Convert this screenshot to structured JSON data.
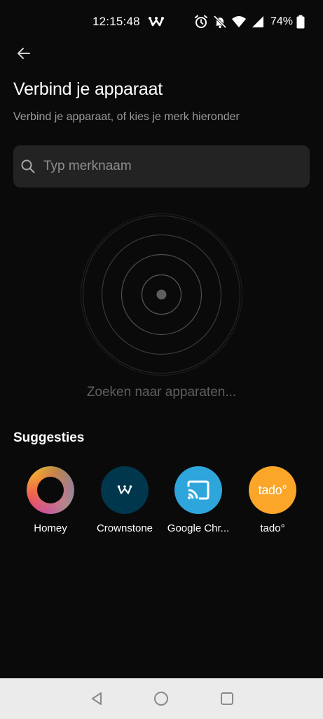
{
  "status_bar": {
    "time": "12:15:48",
    "battery_percent": "74%",
    "icons": [
      "crownstone-app-icon",
      "alarm-icon",
      "bell-off-icon",
      "wifi-icon",
      "signal-icon",
      "battery-icon"
    ]
  },
  "header": {
    "back_icon": "arrow-left-icon",
    "title": "Verbind je apparaat",
    "subtitle": "Verbind je apparaat, of kies je merk hieronder"
  },
  "search": {
    "placeholder": "Typ merknaam",
    "value": ""
  },
  "scan": {
    "status_text": "Zoeken naar apparaten..."
  },
  "suggestions": {
    "title": "Suggesties",
    "items": [
      {
        "label": "Homey",
        "icon": "homey-logo",
        "color": "#e0405f"
      },
      {
        "label": "Crownstone",
        "icon": "crownstone-logo",
        "color": "#00374c"
      },
      {
        "label": "Google Chr...",
        "icon": "chromecast-logo",
        "color": "#2ea6dc"
      },
      {
        "label": "tado°",
        "icon": "tado-logo",
        "color": "#fba629",
        "logo_text": "tado°"
      }
    ]
  },
  "nav_bar": {
    "buttons": [
      "back-triangle-icon",
      "home-circle-icon",
      "recents-square-icon"
    ]
  },
  "colors": {
    "background": "#0a0a0a",
    "search_bg": "#232323",
    "subtitle": "#9a9a9a",
    "scan_text": "#5e5e5e",
    "nav_bar_bg": "#ebebeb"
  }
}
